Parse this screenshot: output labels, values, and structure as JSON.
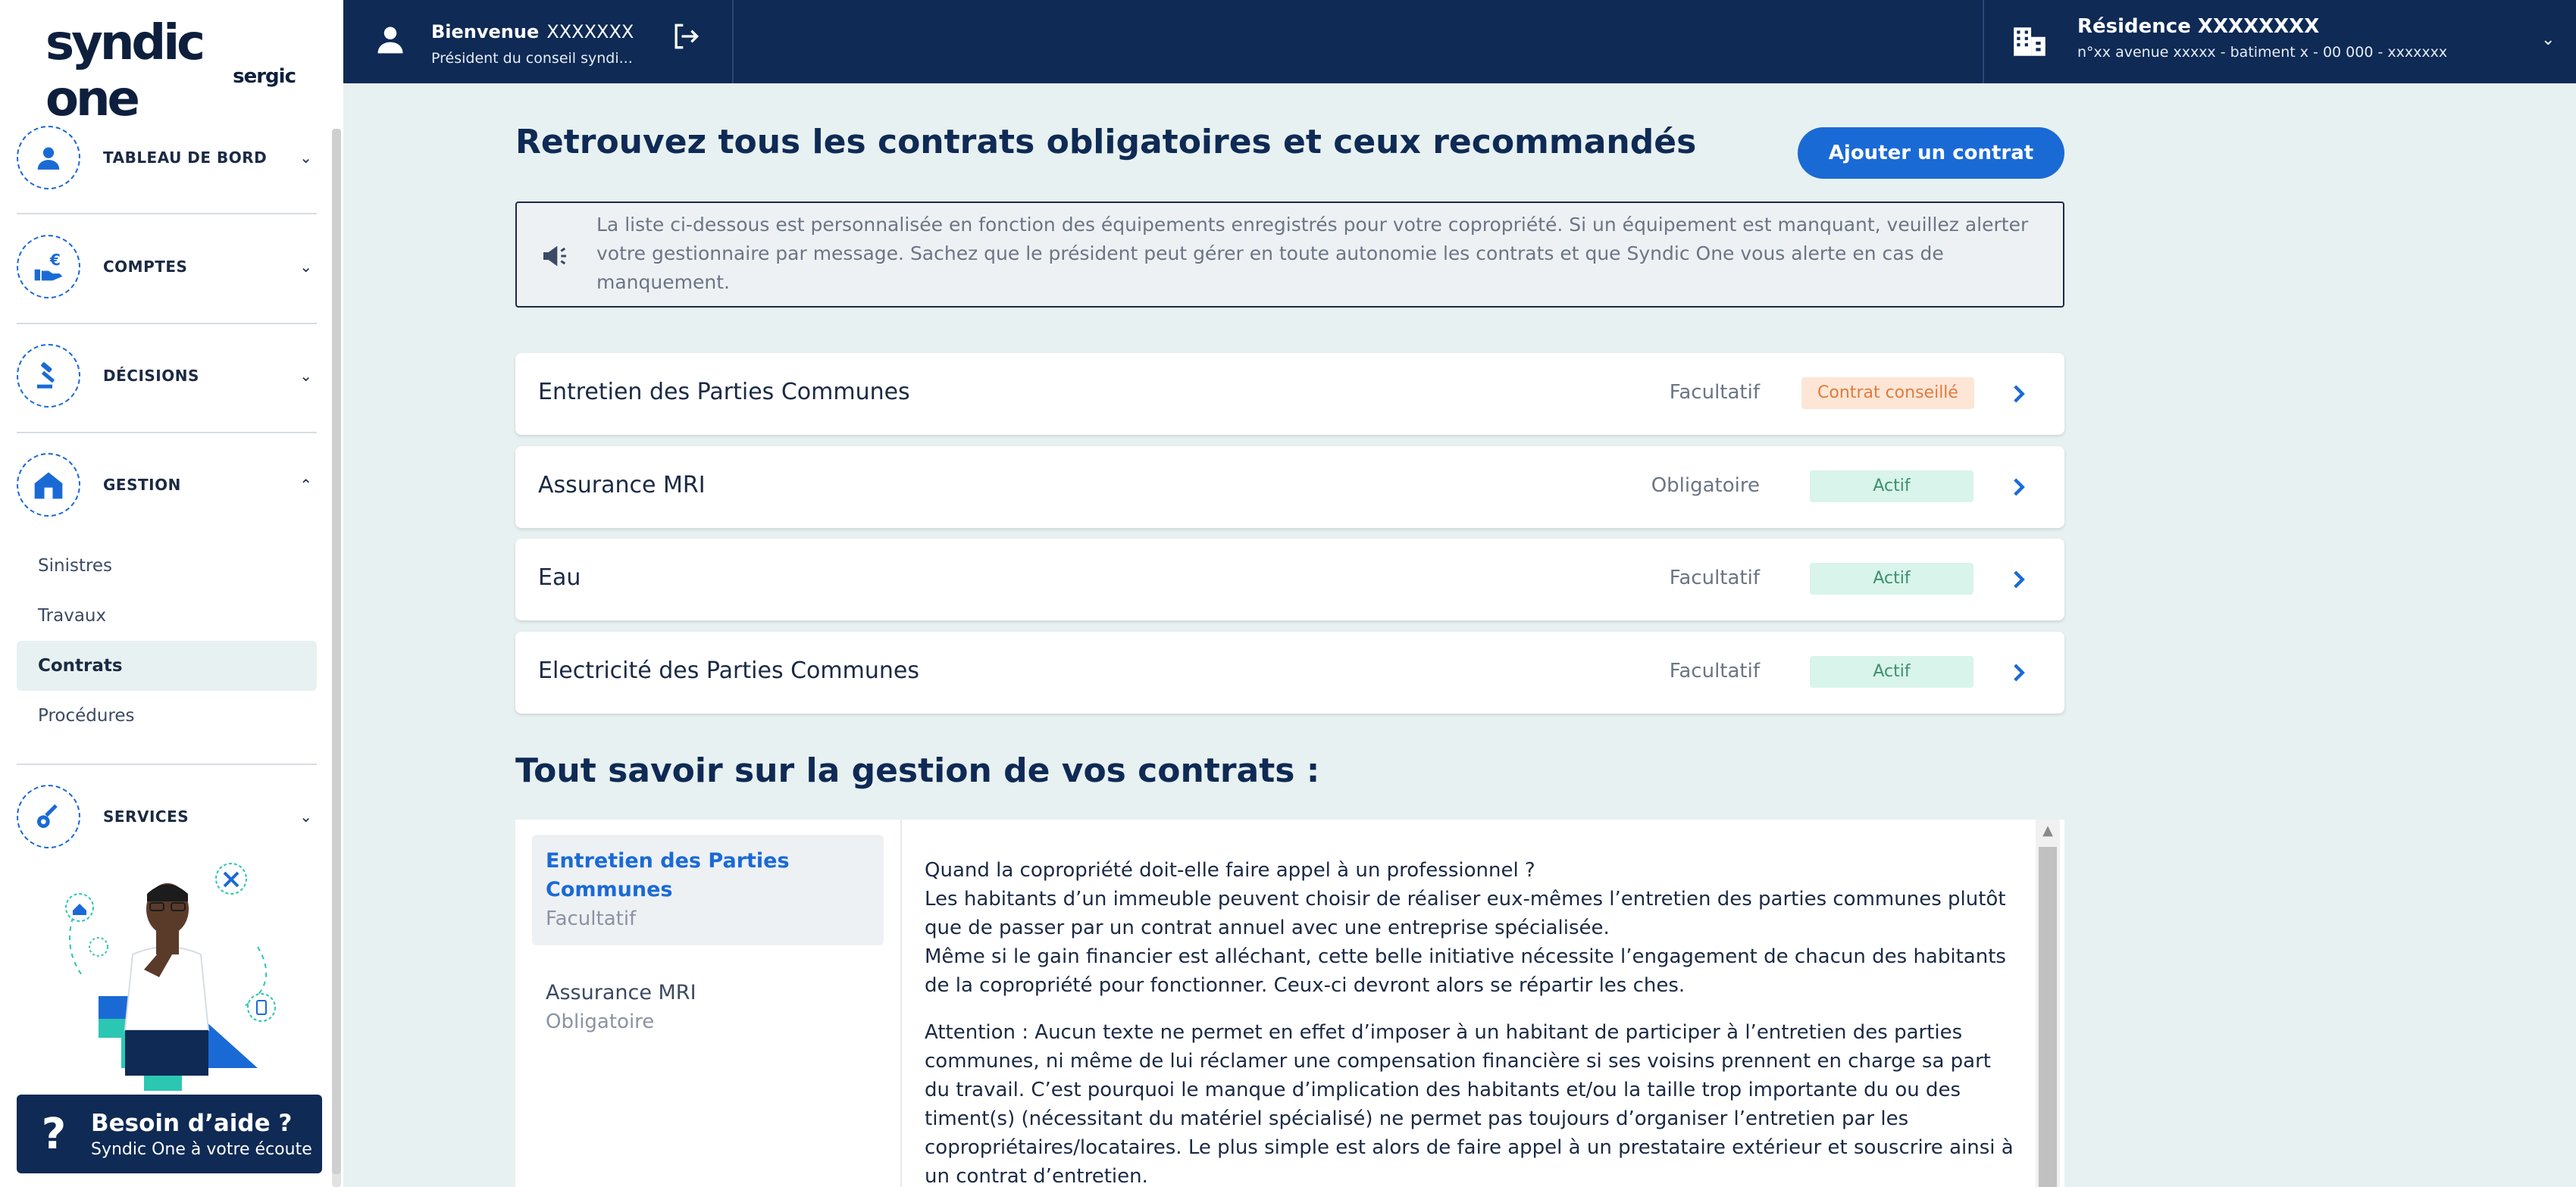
{
  "brand": {
    "main": "syndic one",
    "sub": "sergic"
  },
  "sidebar": {
    "menu": [
      {
        "label": "TABLEAU DE BORD",
        "chevron": "chevron-down-icon"
      },
      {
        "label": "COMPTES",
        "chevron": "chevron-down-icon"
      },
      {
        "label": "DÉCISIONS",
        "chevron": "chevron-down-icon"
      },
      {
        "label": "GESTION",
        "chevron": "chevron-up-icon"
      },
      {
        "label": "SERVICES",
        "chevron": "chevron-down-icon"
      }
    ],
    "sub_items": [
      "Sinistres",
      "Travaux",
      "Contrats",
      "Procédures"
    ],
    "active_sub_item": "Contrats",
    "help": {
      "title": "Besoin d’aide ?",
      "subtitle": "Syndic One à votre écoute"
    }
  },
  "topbar": {
    "welcome": "Bienvenue",
    "user_name": "XXXXXXX",
    "role": "Président du conseil syndi...",
    "residence_title": "Résidence XXXXXXXX",
    "residence_address": "n°xx avenue xxxxx - batiment x - 00 000 - xxxxxxx"
  },
  "main": {
    "title": "Retrouvez tous les contrats obligatoires et ceux recommandés",
    "add_button": "Ajouter un contrat",
    "info_text": "La liste ci-dessous est personnalisée en fonction des équipements enregistrés pour votre copropriété. Si un équipement est manquant, veuillez alerter votre gestionnaire par message. Sachez que le président peut gérer en toute autonomie les contrats et que Syndic One vous alerte en cas de manquement.",
    "contracts": [
      {
        "name": "Entretien des Parties Communes",
        "type": "Facultatif",
        "status": "Contrat conseillé"
      },
      {
        "name": "Assurance MRI",
        "type": "Obligatoire",
        "status": "Actif"
      },
      {
        "name": "Eau",
        "type": "Facultatif",
        "status": "Actif"
      },
      {
        "name": "Electricité des Parties Communes",
        "type": "Facultatif",
        "status": "Actif"
      }
    ],
    "section_title": "Tout savoir sur la gestion de vos contrats :",
    "guide_items": [
      {
        "title": "Entretien des Parties Communes",
        "subtitle": "Facultatif"
      },
      {
        "title": "Assurance MRI",
        "subtitle": "Obligatoire"
      }
    ],
    "guide_paragraphs": [
      {
        "lines": [
          "Quand la copropriété doit-elle faire appel à un professionnel ?",
          "Les habitants d’un immeuble peuvent choisir de réaliser eux-mêmes l’entretien des parties communes plutôt que de passer par un contrat annuel avec une entreprise spécialisée.",
          "Même si le gain financier est alléchant, cette belle initiative nécessite l’engagement de chacun des habitants de la copropriété pour fonctionner. Ceux-ci devront alors se répartir les ches."
        ]
      },
      {
        "lines": [
          "Attention : Aucun texte ne permet en effet d’imposer à un habitant de participer à l’entretien des parties communes, ni même de lui réclamer une compensation financière si ses voisins prennent en charge sa part du travail. C’est pourquoi le manque d’implication des habitants et/ou la taille trop importante du ou des timent(s) (nécessitant du matériel spécialisé) ne permet pas toujours d’organiser l’entretien par les copropriétaires/locataires. Le plus simple est alors de faire appel à un prestataire extérieur et souscrire ainsi à un contrat d’entretien."
        ]
      }
    ]
  },
  "colors": {
    "navy": "#0e2a55",
    "accent_blue": "#1a6ad6",
    "background": "#e8f1f1",
    "badge_green_bg": "#d9f4ea",
    "badge_green_text": "#3d8f6f",
    "badge_orange_bg": "#fde6d6",
    "badge_orange_text": "#e07b3e"
  }
}
